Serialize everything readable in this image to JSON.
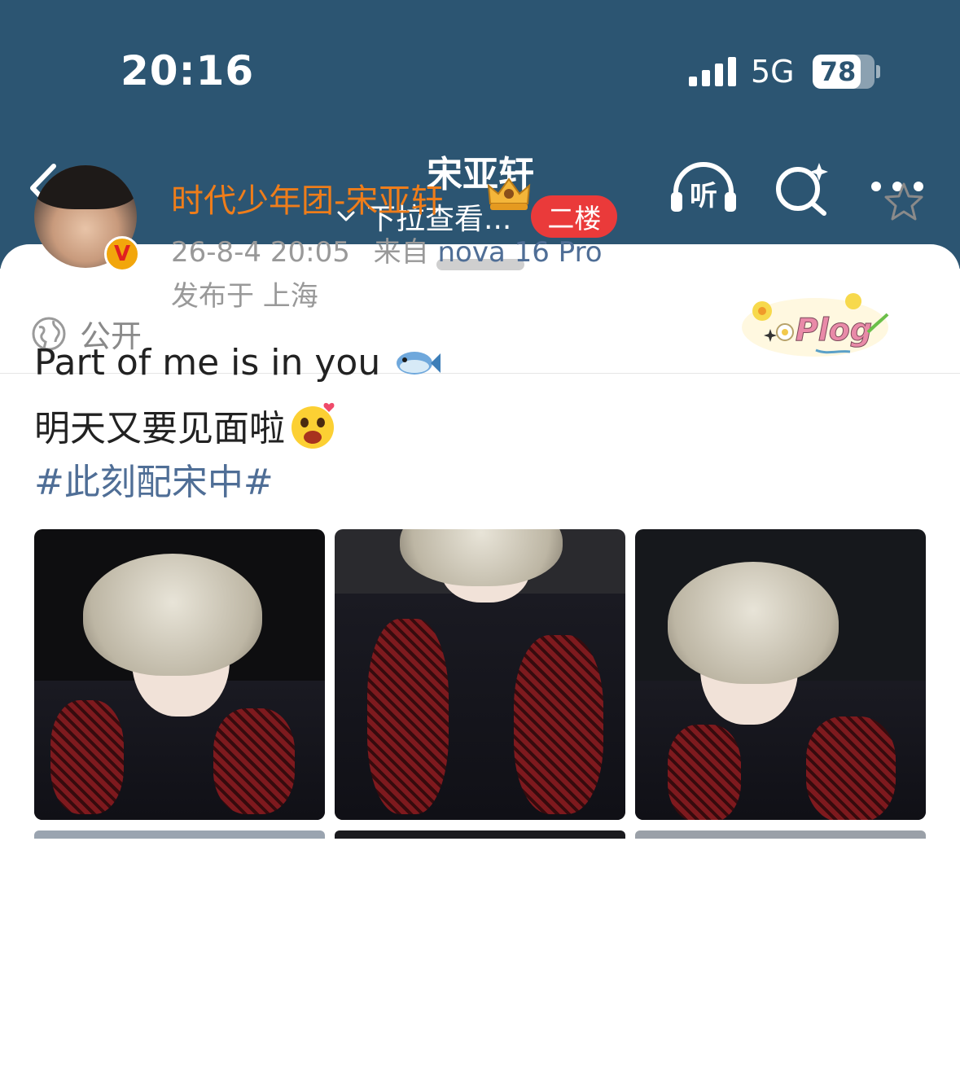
{
  "status_bar": {
    "time": "20:16",
    "network": "5G",
    "battery": "78",
    "battery_level": 0.78
  },
  "nav": {
    "title": "宋亚轩",
    "subtitle": "下拉查看...",
    "floor_badge": "二楼",
    "listen_label": "听"
  },
  "sheet": {
    "visibility": "公开",
    "plog_label": "Plog"
  },
  "post": {
    "author": "时代少年团-宋亚轩",
    "verified_mark": "V",
    "date": "26-8-4 20:05",
    "source_prefix": "来自",
    "device": "nova 16 Pro",
    "location": "发布于 上海",
    "line1": "Part of me is in you",
    "line2": "明天又要见面啦",
    "hashtag": "#此刻配宋中#"
  },
  "colors": {
    "header_bg": "#2c5572",
    "floor_badge": "#ea3a3a",
    "author": "#ef7d1a",
    "link": "#4f6e96"
  }
}
